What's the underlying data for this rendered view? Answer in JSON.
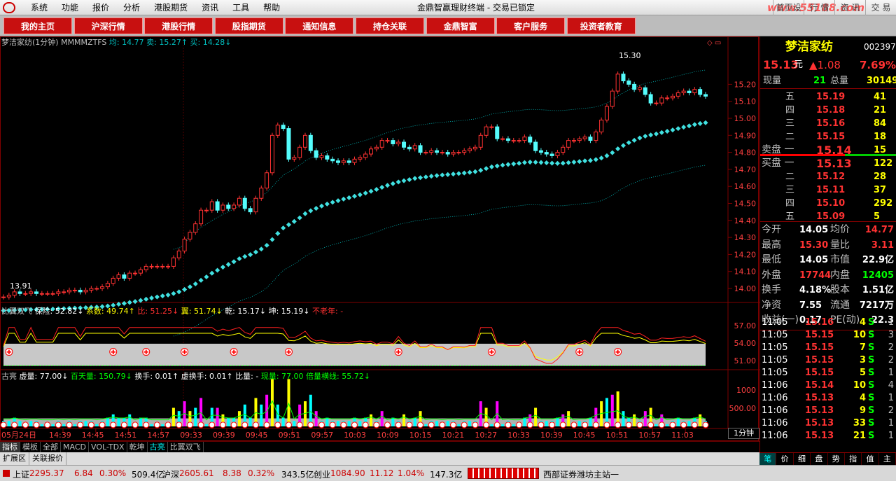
{
  "menu": {
    "items": [
      "系统",
      "功能",
      "报价",
      "分析",
      "港股期货",
      "资讯",
      "工具",
      "帮助"
    ]
  },
  "window": {
    "title": "金鼎智赢理财终端 - 交易已锁定",
    "buttons": [
      "首页设置",
      "行 情",
      "资 讯",
      "交 易"
    ],
    "watermark": "www.55188.com"
  },
  "navbar": {
    "items": [
      "我的主页",
      "沪深行情",
      "港股行情",
      "股指期货",
      "通知信息",
      "持仓关联",
      "金鼎智富",
      "客户服务",
      "投资者教育"
    ]
  },
  "main_chart": {
    "header": {
      "name": "梦洁家纺(1分钟)",
      "indicator": "MMMMZTFS",
      "avg_label": "均:",
      "avg": "14.77",
      "sell_label": "卖:",
      "sell": "15.27",
      "buy_label": "买:",
      "buy": "14.28"
    },
    "high_label": "15.30",
    "low_label": "13.91"
  },
  "ind1": {
    "name": "比翼双飞",
    "items": [
      {
        "label": "保险:",
        "value": "52.82",
        "arrow": "↓",
        "color": "#ffffff"
      },
      {
        "label": "系数:",
        "value": "49.74",
        "arrow": "↑",
        "color": "#ffff00"
      },
      {
        "label": "比:",
        "value": "51.25",
        "arrow": "↓",
        "color": "#ff3030"
      },
      {
        "label": "翼:",
        "value": "51.74",
        "arrow": "↓",
        "color": "#ffff00"
      },
      {
        "label": "乾:",
        "value": "15.17",
        "arrow": "↓",
        "color": "#ffffff"
      },
      {
        "label": "坤:",
        "value": "15.19",
        "arrow": "↓",
        "color": "#ffffff"
      },
      {
        "label": "不老年:",
        "value": "-",
        "arrow": "",
        "color": "#ff3030"
      }
    ]
  },
  "ind2": {
    "name": "古亮",
    "items": [
      {
        "label": "虚量:",
        "value": "77.00",
        "arrow": "↓",
        "color": "#ffffff"
      },
      {
        "label": "百天量:",
        "value": "150.79",
        "arrow": "↓",
        "color": "#00ff00"
      },
      {
        "label": "换手:",
        "value": "0.01",
        "arrow": "↑",
        "color": "#ffffff"
      },
      {
        "label": "虚换手:",
        "value": "0.01",
        "arrow": "↑",
        "color": "#ffffff"
      },
      {
        "label": "比量:",
        "value": "-",
        "arrow": "",
        "color": "#ffffff"
      },
      {
        "label": "现量:",
        "value": "77.00",
        "arrow": "",
        "color": "#00ff00"
      },
      {
        "label": "倍量横线:",
        "value": "55.72",
        "arrow": "↓",
        "color": "#00ff00"
      }
    ]
  },
  "chart_data": {
    "type": "candlestick",
    "interval": "1分钟",
    "date": "05月24日",
    "price_axis": [
      "15.20",
      "15.10",
      "15.00",
      "14.90",
      "14.80",
      "14.70",
      "14.60",
      "14.50",
      "14.40",
      "14.30",
      "14.20",
      "14.10",
      "14.00"
    ],
    "ind1_axis": [
      "57.00",
      "54.00",
      "51.00"
    ],
    "ind2_axis": [
      "1000",
      "500.00"
    ],
    "time_ticks": [
      "14:39",
      "14:45",
      "14:51",
      "14:57",
      "09:33",
      "09:39",
      "09:45",
      "09:51",
      "09:57",
      "10:03",
      "10:09",
      "10:15",
      "10:21",
      "10:27",
      "10:33",
      "10:39",
      "10:45",
      "10:51",
      "10:57",
      "11:03"
    ],
    "close": [
      13.95,
      13.96,
      13.98,
      13.97,
      13.97,
      13.98,
      13.97,
      13.97,
      13.97,
      13.97,
      13.98,
      13.98,
      13.99,
      13.99,
      13.98,
      13.99,
      14.0,
      14.0,
      14.01,
      14.03,
      14.06,
      14.08,
      14.06,
      14.09,
      14.09,
      14.11,
      14.13,
      14.13,
      14.13,
      14.13,
      14.13,
      14.18,
      14.22,
      14.29,
      14.33,
      14.38,
      14.46,
      14.46,
      14.51,
      14.46,
      14.49,
      14.47,
      14.49,
      14.53,
      14.47,
      14.45,
      14.53,
      14.59,
      14.68,
      14.9,
      14.96,
      14.94,
      14.76,
      14.77,
      14.83,
      14.9,
      14.81,
      14.77,
      14.78,
      14.76,
      14.75,
      14.74,
      14.75,
      14.74,
      14.76,
      14.77,
      14.79,
      14.82,
      14.83,
      14.87,
      14.87,
      14.85,
      14.86,
      14.83,
      14.82,
      14.84,
      14.8,
      14.8,
      14.81,
      14.8,
      14.8,
      14.79,
      14.8,
      14.8,
      14.81,
      14.82,
      14.83,
      14.9,
      14.95,
      14.95,
      14.88,
      14.88,
      14.87,
      14.87,
      14.87,
      14.89,
      14.86,
      14.81,
      14.8,
      14.79,
      14.78,
      14.8,
      14.83,
      14.87,
      14.87,
      14.88,
      14.89,
      14.87,
      14.92,
      14.99,
      15.07,
      15.16,
      15.26,
      15.22,
      15.2,
      15.17,
      15.18,
      15.14,
      15.09,
      15.09,
      15.12,
      15.12,
      15.13,
      15.15,
      15.16,
      15.15,
      15.17,
      15.14,
      15.13
    ]
  },
  "quote": {
    "name": "梦洁家纺",
    "code": "002397",
    "price": "15.13",
    "price_unit": "元",
    "change": "▲1.08",
    "change_pct": "7.69%",
    "vol_now_label": "现量",
    "vol_now": "21",
    "vol_total_label": "总量",
    "vol_total": "30149",
    "asks": [
      {
        "label": "五",
        "price": "15.19",
        "vol": "41"
      },
      {
        "label": "四",
        "price": "15.18",
        "vol": "21"
      },
      {
        "label": "三",
        "price": "15.16",
        "vol": "84"
      },
      {
        "label": "二",
        "price": "15.15",
        "vol": "18"
      },
      {
        "label": "卖盘 一",
        "price": "15.14",
        "vol": "15"
      }
    ],
    "bids": [
      {
        "label": "买盘 一",
        "price": "15.13",
        "vol": "122"
      },
      {
        "label": "二",
        "price": "15.12",
        "vol": "28"
      },
      {
        "label": "三",
        "price": "15.11",
        "vol": "37"
      },
      {
        "label": "四",
        "price": "15.10",
        "vol": "292"
      },
      {
        "label": "五",
        "price": "15.09",
        "vol": "5"
      }
    ],
    "stats": [
      [
        "今开",
        "14.05",
        "均价",
        "14.77"
      ],
      [
        "最高",
        "15.30",
        "量比",
        "3.11"
      ],
      [
        "最低",
        "14.05",
        "市值",
        "22.9亿"
      ],
      [
        "外盘",
        "17744",
        "内盘",
        "12405"
      ],
      [
        "换手",
        "4.18%",
        "股本",
        "1.51亿"
      ],
      [
        "净资",
        "7.55",
        "流通",
        "7217万"
      ],
      [
        "收益(一)",
        "0.17",
        "PE(动)",
        "22.3"
      ]
    ],
    "ticks": [
      [
        "11:05",
        "15.16",
        "4",
        "S",
        "1"
      ],
      [
        "11:05",
        "15.15",
        "10",
        "S",
        "3"
      ],
      [
        "11:05",
        "15.15",
        "7",
        "S",
        "2"
      ],
      [
        "11:05",
        "15.15",
        "3",
        "S",
        "2"
      ],
      [
        "11:05",
        "15.15",
        "5",
        "S",
        "1"
      ],
      [
        "11:06",
        "15.14",
        "10",
        "S",
        "4"
      ],
      [
        "11:06",
        "15.13",
        "4",
        "S",
        "1"
      ],
      [
        "11:06",
        "15.13",
        "9",
        "S",
        "2"
      ],
      [
        "11:06",
        "15.13",
        "33",
        "S",
        "1"
      ],
      [
        "11:06",
        "15.13",
        "21",
        "S",
        "1"
      ]
    ]
  },
  "bottom_tabs": [
    "指标",
    "模板",
    "全部",
    "MACD",
    "VOL-TDX",
    "乾坤",
    "古亮",
    "比翼双飞"
  ],
  "bottom_tabs2": [
    "扩展区",
    "关联报价"
  ],
  "right_tabs": [
    "笔",
    "价",
    "细",
    "盘",
    "势",
    "指",
    "值",
    "主"
  ],
  "statusbar": {
    "sh_label": "上证",
    "sh": "2295.37",
    "sh_chg": "6.84",
    "sh_pct": "0.30%",
    "sh_amt": "509.4亿",
    "sz_label": "沪深",
    "sz": "2605.61",
    "sz_chg": "8.38",
    "sz_pct": "0.32%",
    "sz_amt": "343.5亿",
    "cy_label": "创业",
    "cy": "1084.90",
    "cy_chg": "11.12",
    "cy_pct": "1.04%",
    "cy_amt": "147.3亿",
    "broker": "西部证券潍坊主站一"
  }
}
